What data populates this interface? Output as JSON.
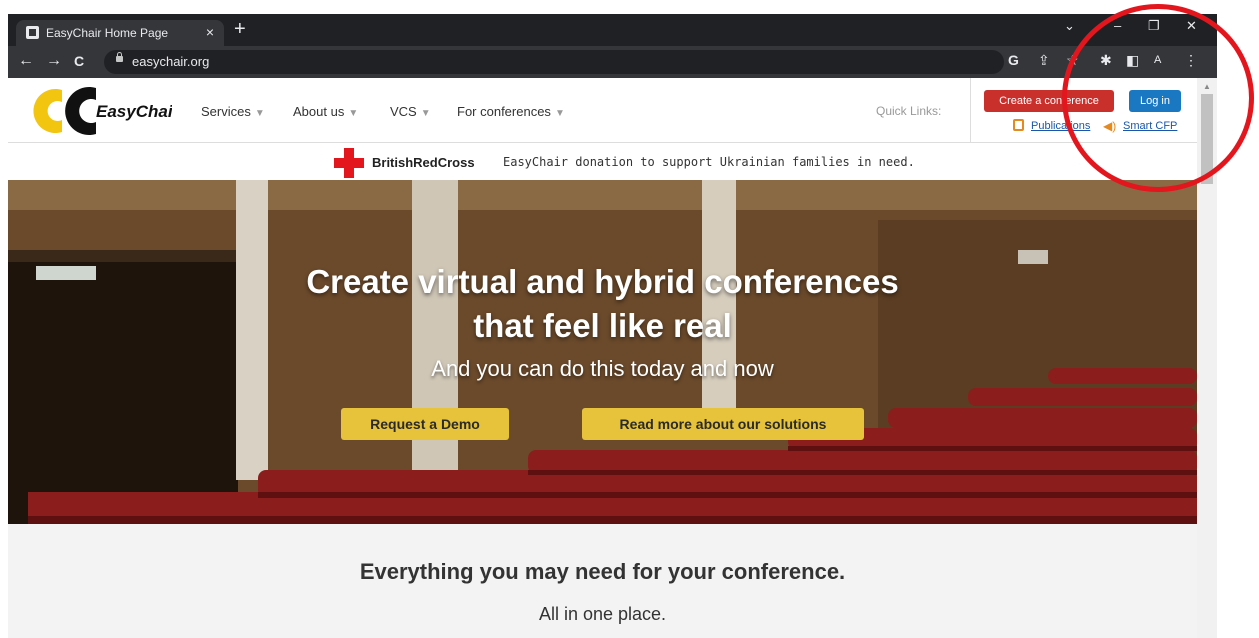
{
  "browser": {
    "tab_title": "EasyChair Home Page",
    "tab_close": "×",
    "new_tab": "+",
    "window_controls": {
      "dropdown": "⌄",
      "minimize": "–",
      "restore": "❐",
      "close": "✕"
    },
    "nav": {
      "back": "←",
      "forward": "→",
      "reload": "C"
    },
    "url": "easychair.org",
    "toolbar_icons": {
      "google": "G",
      "share": "⇪",
      "star": "☆",
      "extensions": "✱",
      "sidepanel": "◧",
      "profile": "A",
      "menu": "⋮"
    }
  },
  "header": {
    "logo_text": "EasyChair",
    "nav_items": [
      {
        "label": "Services",
        "caret": "▼"
      },
      {
        "label": "About us",
        "caret": "▼"
      },
      {
        "label": "VCS",
        "caret": "▼"
      },
      {
        "label": "For conferences",
        "caret": "▼"
      }
    ],
    "quick_links": "Quick Links:",
    "create_button": "Create a conference",
    "login_button": "Log in",
    "publications_link": "Publications",
    "smart_cfp_link": "Smart CFP"
  },
  "banner": {
    "org": "BritishRedCross",
    "text": "EasyChair donation to support Ukrainian families in need."
  },
  "hero": {
    "title_line1": "Create virtual and hybrid conferences",
    "title_line2": "that feel like real",
    "subtitle": "And you can do this today and now",
    "demo_button": "Request a Demo",
    "solutions_button": "Read more about our solutions"
  },
  "section": {
    "title": "Everything you may need for your conference.",
    "subtitle": "All in one place."
  },
  "colors": {
    "annotation": "#e3161e",
    "create_btn": "#c9302c",
    "login_btn": "#1a78c2",
    "hero_btn": "#e6c33a"
  },
  "icons": [
    "favicon-icon",
    "lock-icon",
    "google-icon",
    "share-icon",
    "star-icon",
    "extensions-icon",
    "sidepanel-icon",
    "profile-icon",
    "menu-icon",
    "publications-icon",
    "speaker-icon",
    "red-cross-icon"
  ]
}
